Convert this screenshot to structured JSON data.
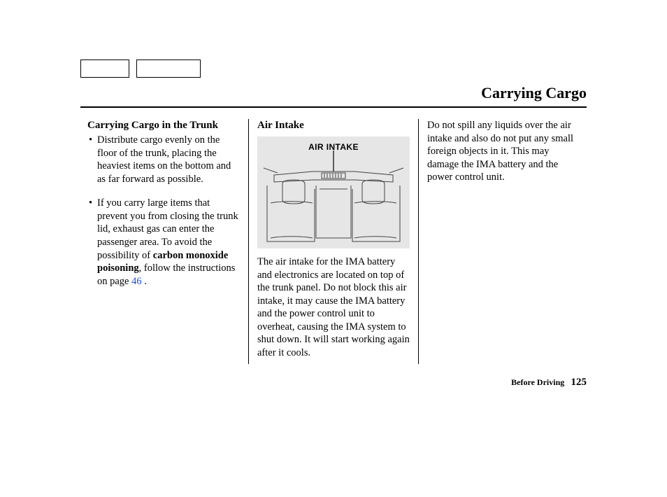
{
  "page_title": "Carrying Cargo",
  "col1": {
    "heading": "Carrying Cargo in the Trunk",
    "bullet1": "Distribute cargo evenly on the floor of the trunk, placing the heaviest items on the bottom and as far forward as possible.",
    "bullet2_before": "If you carry large items that prevent you from closing the trunk lid, exhaust gas can enter the passenger area. To avoid the possibility of ",
    "bullet2_bold": "carbon monoxide poisoning",
    "bullet2_after1": ", follow the instructions on page ",
    "bullet2_pageref": "46",
    "bullet2_after2": " ."
  },
  "col2": {
    "heading": "Air Intake",
    "diagram_label": "AIR INTAKE",
    "text": "The air intake for the IMA battery and electronics are located on top of the trunk panel. Do not block this air intake, it may cause the IMA battery and the power control unit to overheat, causing the IMA system to shut down. It will start working again after it cools."
  },
  "col3": {
    "text": "Do not spill any liquids over the air intake and also do not put any small foreign objects in it. This may damage the IMA battery and the power control unit."
  },
  "footer": {
    "section": "Before Driving",
    "page_number": "125"
  }
}
